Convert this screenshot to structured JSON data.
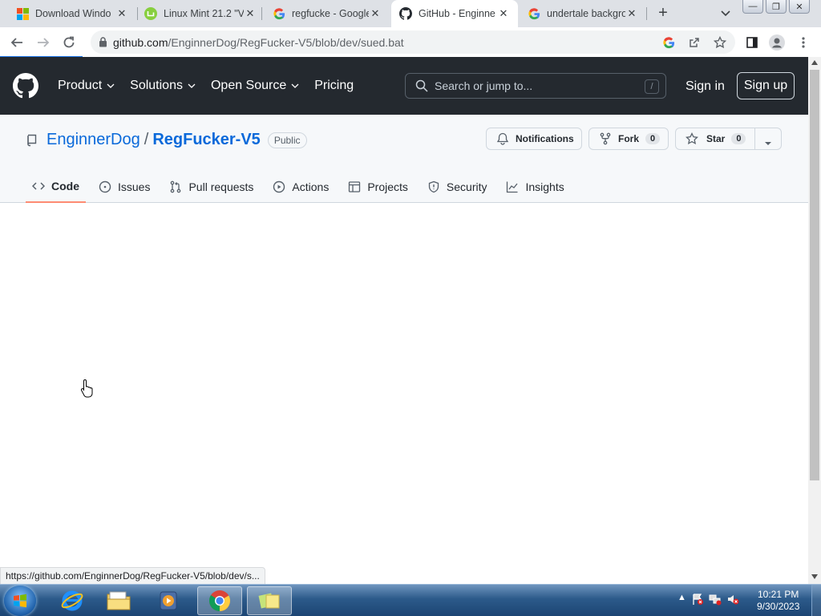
{
  "browser": {
    "tabs": [
      {
        "title": "Download Windo",
        "icon": "windows-logo-icon"
      },
      {
        "title": "Linux Mint 21.2 \"V",
        "icon": "linux-mint-icon"
      },
      {
        "title": "regfucke - Google",
        "icon": "google-icon"
      },
      {
        "title": "GitHub - Enginne",
        "icon": "github-icon",
        "active": true
      },
      {
        "title": "undertale backgro",
        "icon": "google-icon"
      }
    ],
    "url": {
      "host": "github.com",
      "path": "/EnginnerDog/RegFucker-V5/blob/dev/sued.bat"
    },
    "status_url": "https://github.com/EnginnerDog/RegFucker-V5/blob/dev/s..."
  },
  "github": {
    "nav": [
      "Product",
      "Solutions",
      "Open Source",
      "Pricing"
    ],
    "search_placeholder": "Search or jump to...",
    "search_key": "/",
    "sign_in": "Sign in",
    "sign_up": "Sign up"
  },
  "repo": {
    "owner": "EnginnerDog",
    "separator": "/",
    "name": "RegFucker-V5",
    "visibility": "Public",
    "notifications_label": "Notifications",
    "fork_label": "Fork",
    "fork_count": "0",
    "star_label": "Star",
    "star_count": "0",
    "tabs": [
      "Code",
      "Issues",
      "Pull requests",
      "Actions",
      "Projects",
      "Security",
      "Insights"
    ]
  },
  "taskbar": {
    "time": "10:21 PM",
    "date": "9/30/2023"
  },
  "colors": {
    "github_header": "#24292f",
    "link": "#0969da",
    "selected_tab_underline": "#fd8c73"
  }
}
